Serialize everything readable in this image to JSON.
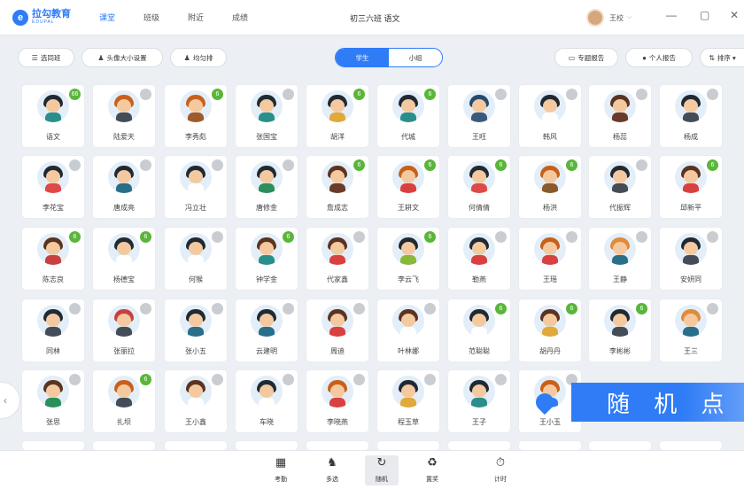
{
  "app": {
    "logo_mark": "e",
    "logo_name": "拉勾教育",
    "logo_sub": "EDUPAL",
    "nav": [
      "课堂",
      "班级",
      "附近",
      "成绩"
    ],
    "active_nav": 0,
    "page_title": "初三六班 语文",
    "user_name": "王校",
    "window_controls": [
      "—",
      "▢",
      "✕"
    ]
  },
  "toolbar": {
    "left_buttons": [
      {
        "icon": "list-icon",
        "glyph": "☰",
        "label": "选同班"
      },
      {
        "icon": "person-icon",
        "glyph": "♟",
        "label": "头像大小设置"
      },
      {
        "icon": "person-icon",
        "glyph": "♟",
        "label": "均匀排"
      }
    ],
    "segment": [
      "学生",
      "小组"
    ],
    "segment_active": 0,
    "right_buttons": [
      {
        "icon": "report-icon",
        "glyph": "▭",
        "label": "专题报告"
      },
      {
        "icon": "star-icon",
        "glyph": "●",
        "label": "个人报告"
      },
      {
        "icon": "sort-icon",
        "glyph": "⇅",
        "label": "排序 ▾"
      }
    ]
  },
  "students": [
    {
      "name": "语文",
      "badge": "66",
      "on": true,
      "hair": "#1f2a33",
      "body": "#2a8f8a"
    },
    {
      "name": "陆爱天",
      "badge": "",
      "on": false,
      "hair": "#c8601a",
      "body": "#444d57"
    },
    {
      "name": "李秀彪",
      "badge": "6",
      "on": true,
      "hair": "#c8601a",
      "body": "#a05a2c"
    },
    {
      "name": "张国宝",
      "badge": "",
      "on": false,
      "hair": "#1f2a33",
      "body": "#2a8f8a"
    },
    {
      "name": "胡洋",
      "badge": "6",
      "on": true,
      "hair": "#1f2a33",
      "body": "#e0a93a"
    },
    {
      "name": "代城",
      "badge": "6",
      "on": true,
      "hair": "#1f2a33",
      "body": "#2a8f8a"
    },
    {
      "name": "王旺",
      "badge": "",
      "on": false,
      "hair": "#274a6b",
      "body": "#3a5a7a"
    },
    {
      "name": "韩风",
      "badge": "",
      "on": false,
      "hair": "#1f2a33",
      "body": "#ffffff"
    },
    {
      "name": "杨蕊",
      "badge": "",
      "on": false,
      "hair": "#5a3420",
      "body": "#6a3a2a"
    },
    {
      "name": "杨成",
      "badge": "",
      "on": false,
      "hair": "#1f2a33",
      "body": "#444d57"
    },
    {
      "name": "李花宝",
      "badge": "",
      "on": false,
      "hair": "#1f2a33",
      "body": "#e04848"
    },
    {
      "name": "唐成亮",
      "badge": "",
      "on": false,
      "hair": "#1f2a33",
      "body": "#2a6f8a"
    },
    {
      "name": "冯立壮",
      "badge": "",
      "on": false,
      "hair": "#1f2a33",
      "body": "#ffffff"
    },
    {
      "name": "唐修金",
      "badge": "",
      "on": false,
      "hair": "#1f2a33",
      "body": "#2a8f5a"
    },
    {
      "name": "詹成志",
      "badge": "6",
      "on": true,
      "hair": "#5a3420",
      "body": "#6a3a2a"
    },
    {
      "name": "王耕文",
      "badge": "6",
      "on": true,
      "hair": "#c8601a",
      "body": "#d94040"
    },
    {
      "name": "何倩倩",
      "badge": "6",
      "on": true,
      "hair": "#1f2a33",
      "body": "#e04848"
    },
    {
      "name": "杨洪",
      "badge": "6",
      "on": true,
      "hair": "#c8601a",
      "body": "#8a5a2a"
    },
    {
      "name": "代振辉",
      "badge": "",
      "on": false,
      "hair": "#1f2a33",
      "body": "#444d57"
    },
    {
      "name": "邱新平",
      "badge": "6",
      "on": true,
      "hair": "#5a3420",
      "body": "#d94040"
    },
    {
      "name": "陈志良",
      "badge": "6",
      "on": true,
      "hair": "#5a3420",
      "body": "#c84040"
    },
    {
      "name": "杨德宝",
      "badge": "6",
      "on": true,
      "hair": "#1f2a33",
      "body": "#ffffff"
    },
    {
      "name": "何猴",
      "badge": "",
      "on": false,
      "hair": "#1f2a33",
      "body": "#ffffff"
    },
    {
      "name": "钟学金",
      "badge": "6",
      "on": true,
      "hair": "#5a3420",
      "body": "#2a8f8a"
    },
    {
      "name": "代家鑫",
      "badge": "",
      "on": false,
      "hair": "#5a3420",
      "body": "#d94040"
    },
    {
      "name": "李云飞",
      "badge": "6",
      "on": true,
      "hair": "#1f2a33",
      "body": "#8ab83a"
    },
    {
      "name": "勒燕",
      "badge": "",
      "on": false,
      "hair": "#1f2a33",
      "body": "#d94040"
    },
    {
      "name": "王瑶",
      "badge": "",
      "on": false,
      "hair": "#c8601a",
      "body": "#d94040"
    },
    {
      "name": "王静",
      "badge": "",
      "on": false,
      "hair": "#e08a3a",
      "body": "#2a6f8a"
    },
    {
      "name": "安妍同",
      "badge": "",
      "on": false,
      "hair": "#1f2a33",
      "body": "#444d57"
    },
    {
      "name": "同林",
      "badge": "",
      "on": false,
      "hair": "#1f2a33",
      "body": "#444d57"
    },
    {
      "name": "张丽拉",
      "badge": "",
      "on": false,
      "hair": "#c84040",
      "body": "#444d57"
    },
    {
      "name": "张小五",
      "badge": "",
      "on": false,
      "hair": "#1f2a33",
      "body": "#2a6f8a"
    },
    {
      "name": "云建明",
      "badge": "",
      "on": false,
      "hair": "#1f2a33",
      "body": "#2a6f8a"
    },
    {
      "name": "周迪",
      "badge": "",
      "on": false,
      "hair": "#5a3420",
      "body": "#d94040"
    },
    {
      "name": "叶林娜",
      "badge": "",
      "on": false,
      "hair": "#5a3420",
      "body": "#ffffff"
    },
    {
      "name": "范聪聪",
      "badge": "6",
      "on": true,
      "hair": "#1f2a33",
      "body": "#ffffff"
    },
    {
      "name": "胡丹丹",
      "badge": "6",
      "on": true,
      "hair": "#5a3420",
      "body": "#e0a93a"
    },
    {
      "name": "李彬彬",
      "badge": "6",
      "on": true,
      "hair": "#1f2a33",
      "body": "#444d57"
    },
    {
      "name": "王三",
      "badge": "",
      "on": false,
      "hair": "#e08a3a",
      "body": "#2a6f8a"
    },
    {
      "name": "张思",
      "badge": "",
      "on": false,
      "hair": "#5a3420",
      "body": "#2a8f5a"
    },
    {
      "name": "扎坝",
      "badge": "6",
      "on": true,
      "hair": "#c8601a",
      "body": "#444d57"
    },
    {
      "name": "王小鑫",
      "badge": "",
      "on": false,
      "hair": "#5a3420",
      "body": "#ffffff"
    },
    {
      "name": "车晓",
      "badge": "",
      "on": false,
      "hair": "#1f2a33",
      "body": "#ffffff"
    },
    {
      "name": "李晓燕",
      "badge": "",
      "on": false,
      "hair": "#c8601a",
      "body": "#d94040"
    },
    {
      "name": "程玉草",
      "badge": "",
      "on": false,
      "hair": "#1f2a33",
      "body": "#e0a93a"
    },
    {
      "name": "王子",
      "badge": "",
      "on": false,
      "hair": "#1f2a33",
      "body": "#2a8f8a"
    },
    {
      "name": "王小玉",
      "badge": "",
      "on": false,
      "hair": "#c8601a",
      "body": "#2f7cf6"
    }
  ],
  "banner": {
    "text": "随 机 点 评"
  },
  "bottom_tools": [
    {
      "icon": "attendance-icon",
      "glyph": "▦",
      "label": "考勤"
    },
    {
      "icon": "multi-select-icon",
      "glyph": "♞",
      "label": "多选"
    },
    {
      "icon": "random-icon",
      "glyph": "↻",
      "label": "随机"
    },
    {
      "icon": "redeem-icon",
      "glyph": "♻",
      "label": "置奖"
    },
    {
      "icon": "timer-icon",
      "glyph": "⏱",
      "label": "计时"
    }
  ],
  "bottom_active": 2,
  "colors": {
    "accent": "#2f7cf6",
    "badge_on": "#59b63a",
    "badge_off": "#c9cdd2",
    "page_bg": "#eceff3"
  }
}
